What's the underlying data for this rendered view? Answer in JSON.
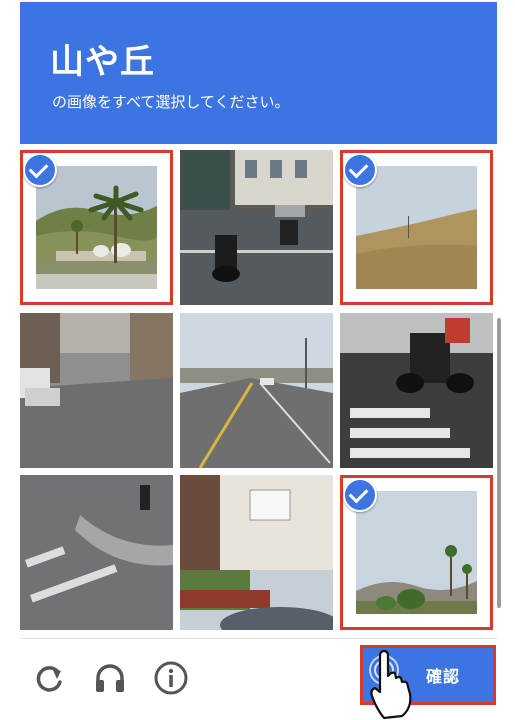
{
  "captcha": {
    "title": "山や丘",
    "instruction": "の画像をすべて選択してください。",
    "tiles": [
      {
        "row": 1,
        "col": 1,
        "selected": true,
        "content": "palm-hill"
      },
      {
        "row": 1,
        "col": 2,
        "selected": false,
        "content": "street-scooters"
      },
      {
        "row": 1,
        "col": 3,
        "selected": true,
        "content": "grassy-hill"
      },
      {
        "row": 2,
        "col": 1,
        "selected": false,
        "content": "residential-street"
      },
      {
        "row": 2,
        "col": 2,
        "selected": false,
        "content": "avenue"
      },
      {
        "row": 2,
        "col": 3,
        "selected": false,
        "content": "crosswalk-scooter"
      },
      {
        "row": 3,
        "col": 1,
        "selected": false,
        "content": "intersection"
      },
      {
        "row": 3,
        "col": 2,
        "selected": false,
        "content": "houses"
      },
      {
        "row": 3,
        "col": 3,
        "selected": true,
        "content": "distant-mountains"
      }
    ],
    "footer": {
      "icons": [
        "reload-icon",
        "headphones-icon",
        "info-icon"
      ],
      "verify_label": "確認"
    }
  },
  "colors": {
    "accent": "#3c75e2",
    "highlight": "#d93a2b"
  }
}
